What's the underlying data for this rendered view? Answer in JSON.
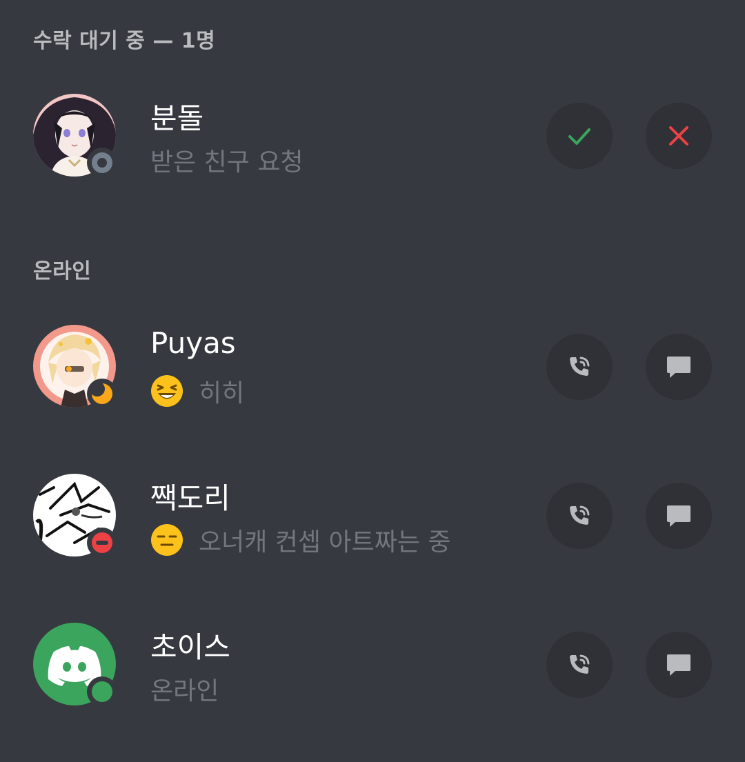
{
  "sections": {
    "pending_header": "수락 대기 중 — 1명",
    "online_header": "온라인"
  },
  "pending": [
    {
      "name": "분돌",
      "subtitle": "받은 친구 요청",
      "status": "offline",
      "avatar_icon": "anime-character-avatar",
      "actions": [
        "accept-icon",
        "decline-icon"
      ]
    }
  ],
  "online": [
    {
      "name": "Puyas",
      "subtitle": "히히",
      "status_emoji": "laughing-face",
      "status": "idle",
      "avatar_icon": "anime-character-avatar",
      "actions": [
        "voice-call-icon",
        "message-icon"
      ]
    },
    {
      "name": "짹도리",
      "subtitle": "오너캐 컨셉 아트짜는 중",
      "status_emoji": "expressionless-face",
      "status": "dnd",
      "avatar_icon": "sketch-avatar",
      "actions": [
        "voice-call-icon",
        "message-icon"
      ]
    },
    {
      "name": "초이스",
      "subtitle": "온라인",
      "status": "online",
      "avatar_icon": "discord-logo-avatar",
      "actions": [
        "voice-call-icon",
        "message-icon"
      ]
    }
  ],
  "colors": {
    "background": "#36393f",
    "button_bg": "#2f3136",
    "accept": "#3ba55d",
    "decline": "#ed4245",
    "idle": "#faa81a",
    "dnd": "#ed4245",
    "online": "#3ba55d",
    "offline": "#747f8d",
    "muted_text": "#72767d"
  }
}
